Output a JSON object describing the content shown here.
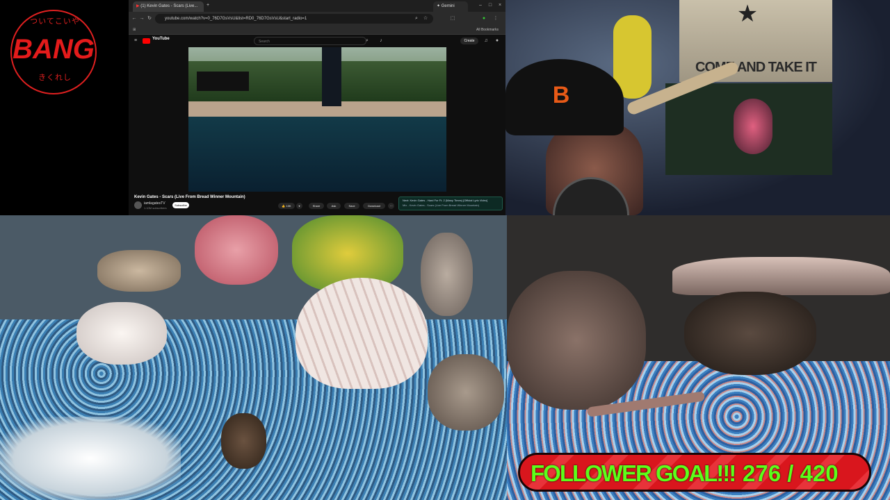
{
  "logo": {
    "top_text": "ついてこいや",
    "main_text": "BANG",
    "bottom_text": "きくれし"
  },
  "browser": {
    "tab_title": "(1) Kevin Gates - Scars (Live...",
    "gemini_tab": "Gemini",
    "url": "youtube.com/watch?v=0_76D7GsVsU&list=RD0_76D7GsVsU&start_radio=1",
    "all_bookmarks": "All Bookmarks",
    "youtube": {
      "logo": "YouTube",
      "search_placeholder": "Search",
      "create_label": "Create",
      "video_title": "Kevin Gates - Scars (Live From Bread Winner Mountain)",
      "channel": "iamlagatesTV",
      "subscribers": "1.10M subscribers",
      "subscribe_label": "Subscribe",
      "likes": "10K",
      "share_label": "Share",
      "ask_label": "Ask",
      "save_label": "Save",
      "download_label": "Download",
      "next_title": "Next: Kevin Gates - Hard For Ft. 2 (Many Times) [Official Lyric Video]",
      "next_sub": "Mix - Kevin Gates - Scars (Live From Bread Winner Mountain)"
    }
  },
  "webcam": {
    "flag_text": "COME AND TAKE IT"
  },
  "goal": {
    "label": "FOLLOWER GOAL!!!",
    "count": "276 / 420",
    "current": 276,
    "target": 420
  },
  "colors": {
    "logo_red": "#e41b1b",
    "goal_red": "#d9161d",
    "goal_green": "#5cff1a"
  }
}
